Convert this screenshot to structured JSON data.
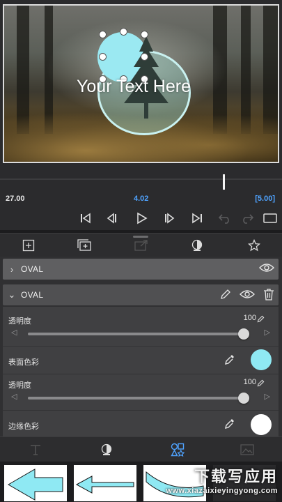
{
  "canvas": {
    "overlay_text": "Your Text Here"
  },
  "timeline": {
    "start_time": "27.00",
    "current_time": "4.02",
    "end_time": "[5.00]"
  },
  "transport": [
    "skip-to-start-icon",
    "step-back-icon",
    "play-icon",
    "step-forward-icon",
    "skip-to-end-icon",
    "undo-icon",
    "redo-icon",
    "aspect-ratio-icon"
  ],
  "tool_tabs": [
    "add-layer-icon",
    "duplicate-layer-icon",
    "export-layer-icon",
    "mask-icon",
    "favorite-star-icon"
  ],
  "layers": [
    {
      "name": "OVAL",
      "expanded": false
    },
    {
      "name": "OVAL",
      "expanded": true
    }
  ],
  "properties": {
    "opacity1_label": "透明度",
    "opacity1_value": "100",
    "fill_color_label": "表面色彩",
    "fill_color": "#8fe9f3",
    "opacity2_label": "透明度",
    "opacity2_value": "100",
    "stroke_color_label": "边缘色彩",
    "stroke_color": "#ffffff"
  },
  "bottom_tabs": [
    "text-tool-icon",
    "style-icon",
    "shapes-icon",
    "image-icon"
  ],
  "watermark": {
    "cn": "下载写应用",
    "url": "www.xiazaixieyingyong.com"
  },
  "colors": {
    "accent_blue": "#4fa3ff",
    "panel": "#303032",
    "row": "#5f5f61"
  }
}
